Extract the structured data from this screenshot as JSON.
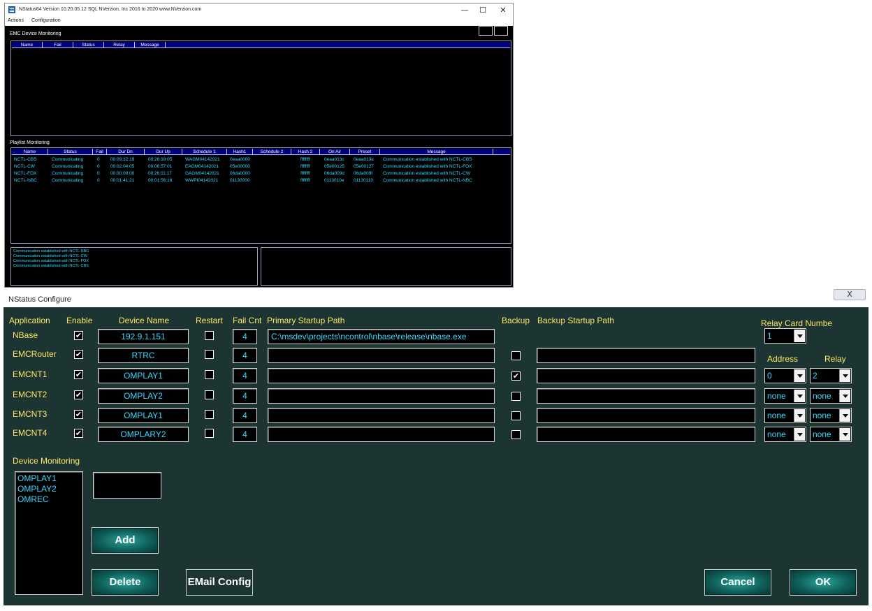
{
  "nstatus": {
    "title": "NStatus64 Version 10.20.05.12 SQL NVerzion, Inc 2016 to 2020 www.NVerzion.com",
    "controls": {
      "minimize": "—",
      "maximize": "☐",
      "close": "✕"
    },
    "menu": {
      "actions": "Actions",
      "configuration": "Configuration"
    },
    "emc": {
      "label": "EMC Device Monitoring",
      "columns": [
        "Name",
        "Fail",
        "Status",
        "Relay",
        "Message"
      ]
    },
    "playlist": {
      "label": "Playlist Monitoring",
      "columns": [
        "Name",
        "Status",
        "Fail",
        "Dur Dn",
        "Dur Up",
        "Schedule 1",
        "Hash1",
        "Schedule 2",
        "Hash 2",
        "On Air",
        "Preset",
        "Message"
      ],
      "rows": [
        {
          "name": "NCTL-CBS",
          "status": "Communicating",
          "fail": "0",
          "dur_dn": "00:09:32:19",
          "dur_up": "00:26:19:05",
          "schedule1": "WAGM04142021",
          "hash1": "0eaa0000",
          "schedule2": "",
          "hash2": "ffffffff",
          "on_air": "0eaa013c",
          "preset": "0eaa013e",
          "message": "Communication established with NCTL-CBS"
        },
        {
          "name": "NCTL-CW",
          "status": "Communicating",
          "fail": "0",
          "dur_dn": "00:02:04:05",
          "dur_up": "00:06:57:01",
          "schedule1": "EAGM04142021",
          "hash1": "05e00000",
          "schedule2": "",
          "hash2": "ffffffff",
          "on_air": "05e00125",
          "preset": "05e00127",
          "message": "Communication established with NCTL-FOX"
        },
        {
          "name": "NCTL-FOX",
          "status": "Communicating",
          "fail": "0",
          "dur_dn": "00:00:00:00",
          "dur_up": "00:26:11:17",
          "schedule1": "GAGM04142021",
          "hash1": "06da0000",
          "schedule2": "",
          "hash2": "ffffffff",
          "on_air": "06da009d",
          "preset": "06da009f",
          "message": "Communication established with NCTL-CW"
        },
        {
          "name": "NCTL-NBC",
          "status": "Communicating",
          "fail": "0",
          "dur_dn": "00:01:41:21",
          "dur_up": "00:01:56:16",
          "schedule1": "WWPI04142021",
          "hash1": "01130000",
          "schedule2": "",
          "hash2": "ffffffff",
          "on_air": "0113010e",
          "preset": "01130110",
          "message": "Communication established with NCTL-NBC"
        }
      ]
    },
    "log": [
      "Communication established with NCTL-NBC",
      "Communication established with NCTL-CW",
      "Communication established with NCTL-FOX",
      "Communication established with NCTL-CBS"
    ]
  },
  "configure": {
    "title": "NStatus Configure",
    "close": "X",
    "headers": {
      "application": "Application",
      "enable": "Enable",
      "device_name": "Device Name",
      "restart": "Restart",
      "fail_cnt": "Fail Cnt",
      "primary_path": "Primary Startup Path",
      "backup": "Backup",
      "backup_path": "Backup Startup Path",
      "relay_card": "Relay Card Numbe",
      "address": "Address",
      "relay": "Relay"
    },
    "relay_card_value": "1",
    "rows": [
      {
        "app": "NBase",
        "enable": "✔",
        "device": "192.9.1.151",
        "restart": "",
        "fail": "4",
        "primary": "C:\\msdev\\projects\\ncontrol\\nbase\\release\\nbase.exe",
        "backup": "",
        "backup_path": "",
        "address": "",
        "relay": ""
      },
      {
        "app": "EMCRouter",
        "enable": "✔",
        "device": "RTRC",
        "restart": "",
        "fail": "4",
        "primary": "",
        "backup": "",
        "backup_path": "",
        "address": "",
        "relay": ""
      },
      {
        "app": "EMCNT1",
        "enable": "✔",
        "device": "OMPLAY1",
        "restart": "",
        "fail": "4",
        "primary": "",
        "backup": "✔",
        "backup_path": "",
        "address": "0",
        "relay": "2"
      },
      {
        "app": "EMCNT2",
        "enable": "✔",
        "device": "OMPLAY2",
        "restart": "",
        "fail": "4",
        "primary": "",
        "backup": "",
        "backup_path": "",
        "address": "none",
        "relay": "none"
      },
      {
        "app": "EMCNT3",
        "enable": "✔",
        "device": "OMPLAY1",
        "restart": "",
        "fail": "4",
        "primary": "",
        "backup": "",
        "backup_path": "",
        "address": "none",
        "relay": "none"
      },
      {
        "app": "EMCNT4",
        "enable": "✔",
        "device": "OMPLARY2",
        "restart": "",
        "fail": "4",
        "primary": "",
        "backup": "",
        "backup_path": "",
        "address": "none",
        "relay": "none"
      }
    ],
    "device_monitoring": {
      "label": "Device Monitoring",
      "items": [
        "OMPLAY1",
        "OMPLAY2",
        "OMREC"
      ],
      "new_device": ""
    },
    "buttons": {
      "add": "Add",
      "delete": "Delete",
      "email": "EMail Config",
      "cancel": "Cancel",
      "ok": "OK"
    }
  }
}
